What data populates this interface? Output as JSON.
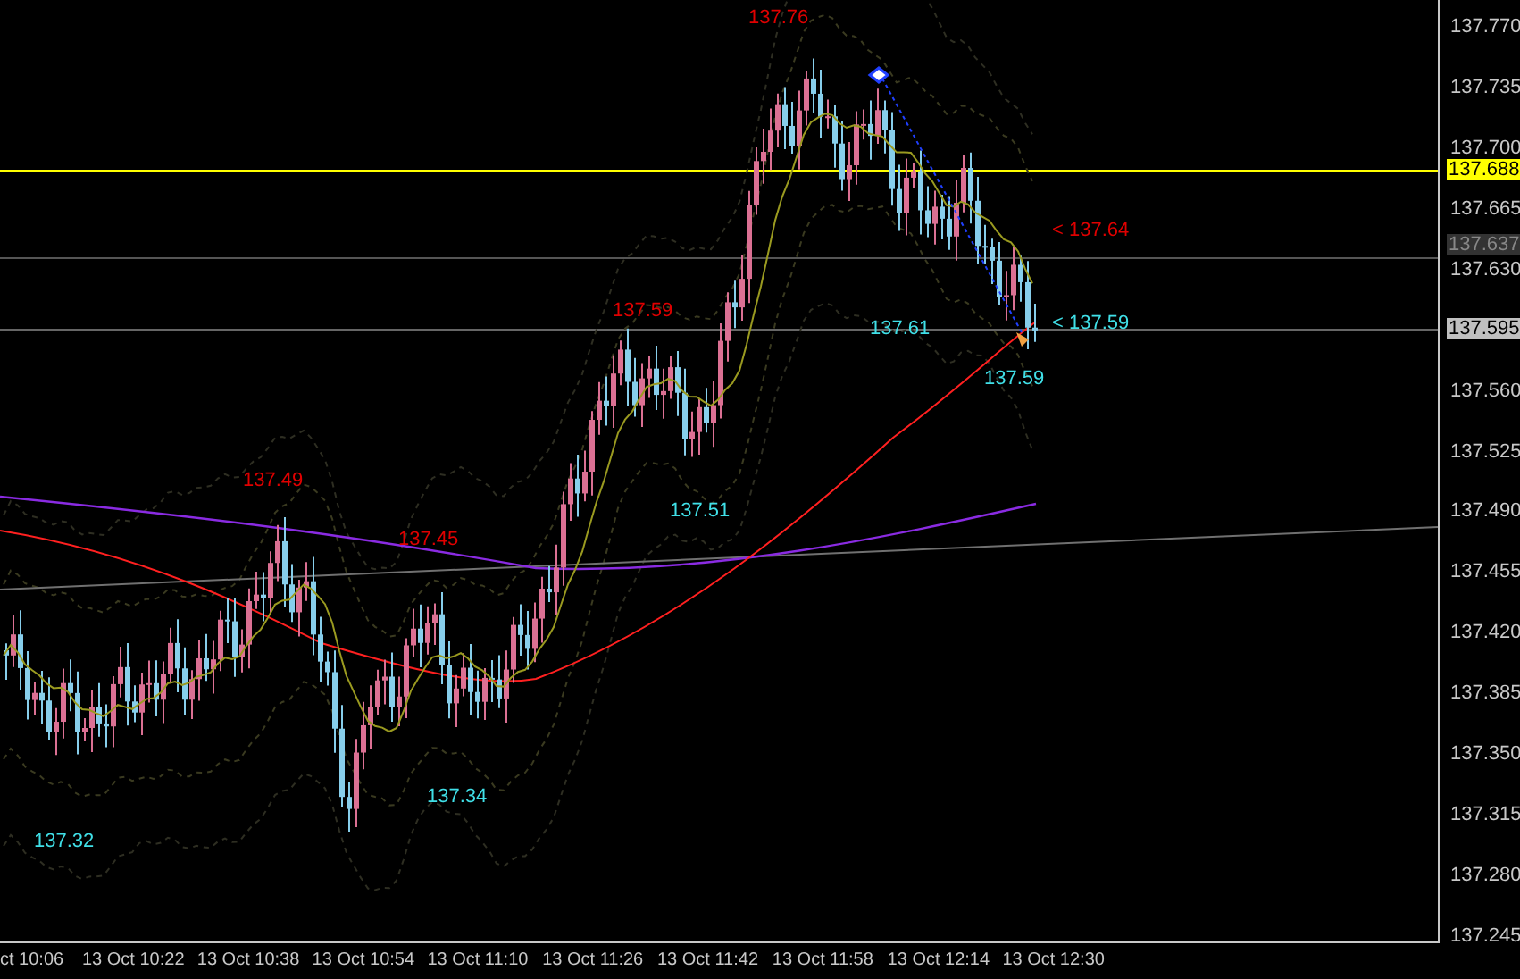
{
  "price_axis": {
    "ticks": [
      "137.770",
      "137.735",
      "137.700",
      "137.665",
      "137.630",
      "137.560",
      "137.525",
      "137.490",
      "137.455",
      "137.420",
      "137.385",
      "137.350",
      "137.315",
      "137.280",
      "137.245"
    ]
  },
  "price_tags": [
    {
      "text": "137.688",
      "color": "#ffff00"
    },
    {
      "text": "137.637",
      "color": "#333333"
    },
    {
      "text": "137.595",
      "color": "#c0c0c0"
    }
  ],
  "time_axis": {
    "labels": [
      "ct 10:06",
      "13 Oct 10:22",
      "13 Oct 10:38",
      "13 Oct 10:54",
      "13 Oct 11:10",
      "13 Oct 11:26",
      "13 Oct 11:42",
      "13 Oct 11:58",
      "13 Oct 12:14",
      "13 Oct 12:30"
    ]
  },
  "annotations": [
    {
      "text": "137.76",
      "color": "#e00000"
    },
    {
      "text": "137.59",
      "color": "#e00000"
    },
    {
      "text": "137.61",
      "color": "#40e0e8"
    },
    {
      "text": "< 137.64",
      "color": "#e00000"
    },
    {
      "text": "< 137.59",
      "color": "#40e0e8"
    },
    {
      "text": "137.59",
      "color": "#40e0e8"
    },
    {
      "text": "137.49",
      "color": "#e00000"
    },
    {
      "text": "137.45",
      "color": "#e00000"
    },
    {
      "text": "137.51",
      "color": "#40e0e8"
    },
    {
      "text": "137.34",
      "color": "#40e0e8"
    },
    {
      "text": "137.32",
      "color": "#40e0e8"
    }
  ]
}
